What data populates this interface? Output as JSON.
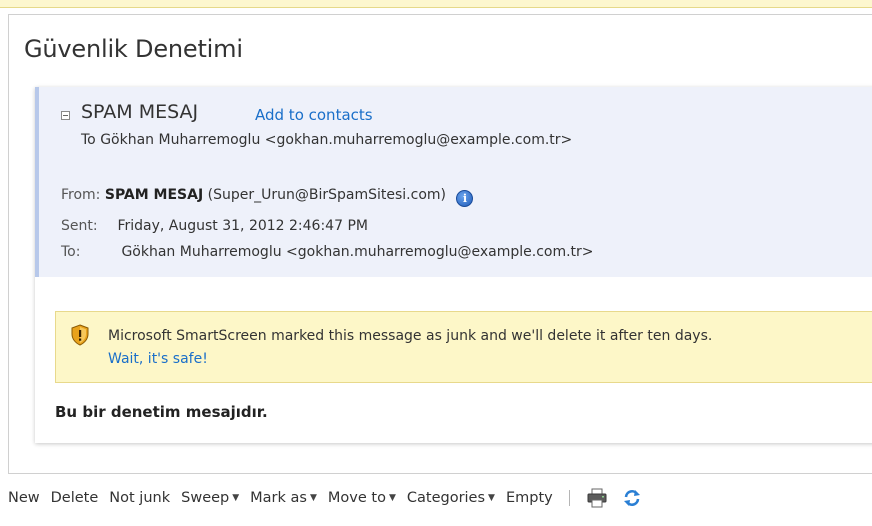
{
  "window": {
    "title": "Güvenlik Denetimi"
  },
  "message": {
    "sender_display": "SPAM MESAJ",
    "add_contacts_label": "Add to contacts",
    "to_summary": "To Gökhan Muharremoglu <gokhan.muharremoglu@example.com.tr>",
    "from_label": "From:",
    "from_name": "SPAM MESAJ",
    "from_email": "(Super_Urun@BirSpamSitesi.com)",
    "sent_label": "Sent:",
    "sent_value": "Friday, August 31, 2012 2:46:47 PM",
    "to_label": "To:",
    "to_value": "Gökhan Muharremoglu <gokhan.muharremoglu@example.com.tr>",
    "body": "Bu bir denetim mesajıdır."
  },
  "warning": {
    "text": "Microsoft SmartScreen marked this message as junk and we'll delete it after ten days.",
    "safe_link": "Wait, it's safe!"
  },
  "toolbar": {
    "new": "New",
    "delete": "Delete",
    "not_junk": "Not junk",
    "sweep": "Sweep",
    "mark_as": "Mark as",
    "move_to": "Move to",
    "categories": "Categories",
    "empty": "Empty",
    "caret": "▼"
  },
  "icons": {
    "info": "info-icon",
    "shield": "shield-warning-icon",
    "print": "print-icon",
    "refresh": "refresh-icon"
  },
  "colors": {
    "link": "#1a6fc9",
    "header_bg": "#eef1fa",
    "warning_bg": "#fdf7c8"
  }
}
